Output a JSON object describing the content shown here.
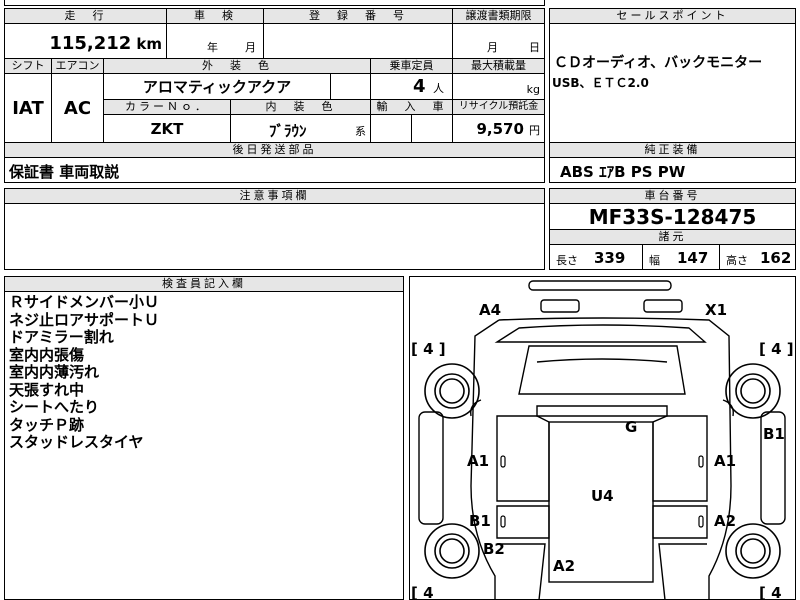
{
  "vehicle": {
    "mileage_label": "走　行",
    "mileage_value": "115,212",
    "mileage_unit": "km",
    "inspection_label": "車　検",
    "inspection_year": "年",
    "inspection_month": "月",
    "registration_label": "登　録　番　号",
    "transfer_label": "譲渡書類期限",
    "transfer_month": "月",
    "transfer_day": "日",
    "shift_label": "シフト",
    "shift_value": "IAT",
    "ac_label": "エアコン",
    "ac_value": "AC",
    "exterior_color_label": "外　装　色",
    "exterior_color_value": "アロマティックアクア",
    "capacity_label": "乗車定員",
    "capacity_value": "4",
    "capacity_unit": "人",
    "max_load_label": "最大積載量",
    "max_load_unit": "kg",
    "color_no_label": "カラーＮｏ．",
    "color_no_value": "ZKT",
    "interior_color_label": "内　装　色",
    "interior_color_value": "ﾌﾞﾗｳﾝ",
    "interior_color_suffix": "系",
    "import_label": "輸　入　車",
    "recycle_label": "リサイクル預託金",
    "recycle_value": "9,570",
    "recycle_unit": "円"
  },
  "sales_point": {
    "label": "セールスポイント",
    "line1": "ＣＤオーディオ、バックモニター",
    "line2": "USB、ＥＴＣ2.0"
  },
  "accessories": {
    "label": "後日発送部品",
    "value": "保証書 車両取説"
  },
  "genuine_equipment": {
    "label": "純正装備",
    "value": "ABS ｴｱB PS PW"
  },
  "notes": {
    "label": "注意事項欄"
  },
  "chassis": {
    "label": "車台番号",
    "value": "MF33S-128475"
  },
  "specs": {
    "label": "諸元",
    "length_label": "長さ",
    "length_value": "339",
    "width_label": "幅",
    "width_value": "147",
    "height_label": "高さ",
    "height_value": "162"
  },
  "inspector": {
    "label": "検査員記入欄",
    "lines": [
      "Ｒサイドメンバー小Ｕ",
      "ネジ止ロアサポートＵ",
      "ドアミラー割れ",
      "室内内張傷",
      "室内内薄汚れ",
      "天張すれ中",
      "シートへたり",
      "タッチＰ跡",
      "スタッドレスタイヤ"
    ]
  },
  "diagram": {
    "tire_fl": "[ 4 ]",
    "tire_fr": "[ 4 ]",
    "tire_rl": "[ 4",
    "tire_rr": "[ 4",
    "marks": {
      "a4": "A4",
      "x1": "X1",
      "g": "G",
      "b1_right": "B1",
      "a1_left": "A1",
      "a1_right": "A1",
      "u4": "U4",
      "b1_left": "B1",
      "a2_right": "A2",
      "b2": "B2",
      "a2_bottom": "A2"
    }
  }
}
